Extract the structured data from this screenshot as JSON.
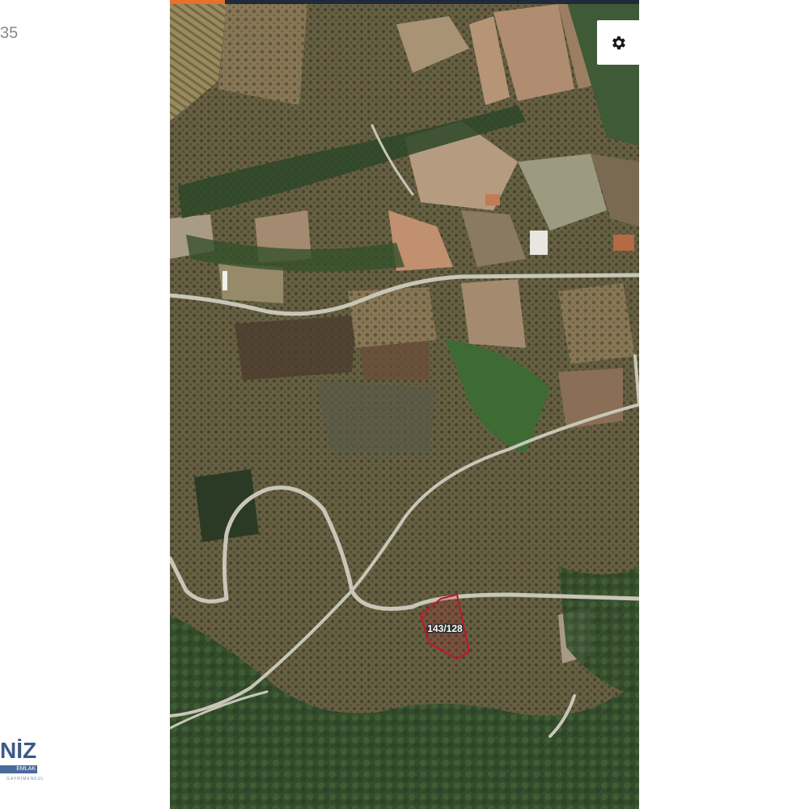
{
  "page": {
    "corner_text": "35"
  },
  "logo": {
    "main": "NİZ",
    "sub": "EMLAK",
    "tiny": "GAYRİMENKUL"
  },
  "map": {
    "view": "satellite",
    "controls": {
      "settings_icon": "gear-icon"
    },
    "parcel": {
      "label": "143/128",
      "outline_color": "#c0162b"
    },
    "colors": {
      "top_bar": "#1f2a3a",
      "top_accent": "#e8702a"
    }
  }
}
